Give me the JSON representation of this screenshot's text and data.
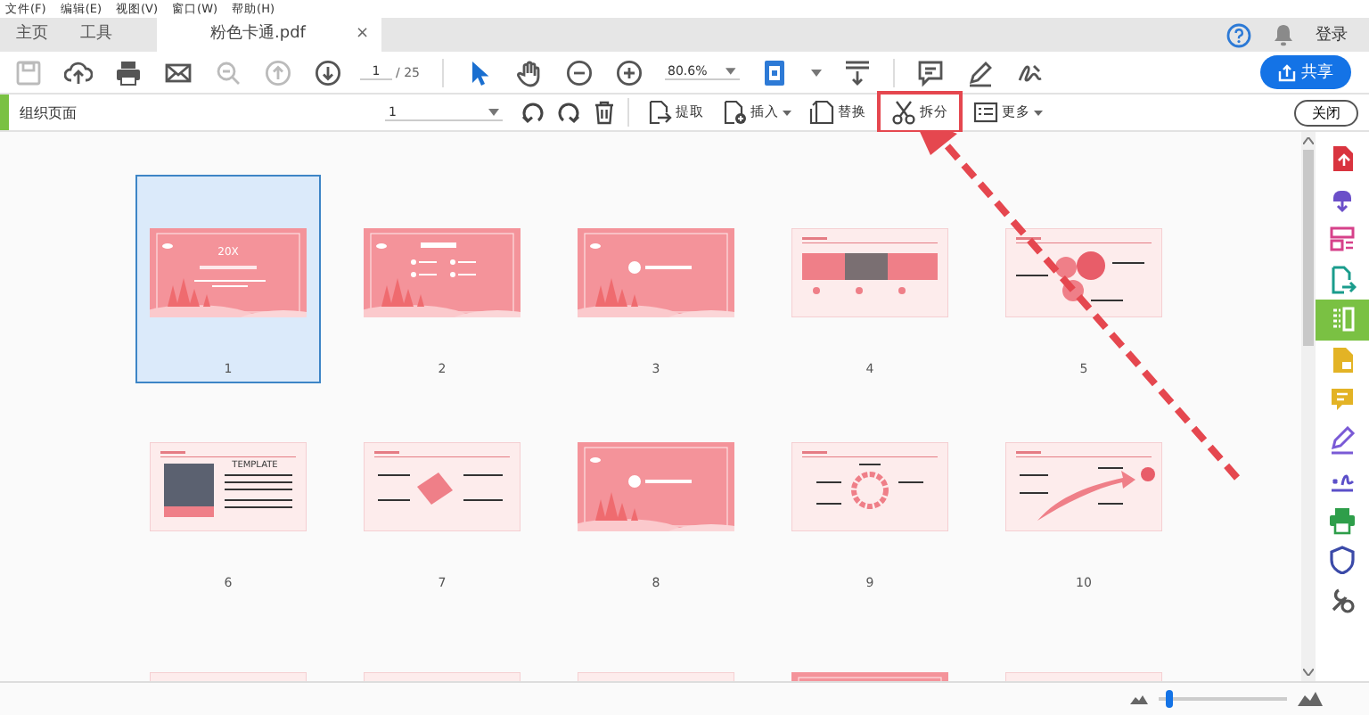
{
  "menu_bar": [
    "文件(F)",
    "编辑(E)",
    "视图(V)",
    "窗口(W)",
    "帮助(H)"
  ],
  "tabs": [
    {
      "label": "主页",
      "selected": false
    },
    {
      "label": "工具",
      "selected": false
    },
    {
      "label": "粉色卡通.pdf",
      "selected": true,
      "close": "×"
    }
  ],
  "account": {
    "sign_in": "登录"
  },
  "toolbar": {
    "page": "1",
    "page_total": "/ 25",
    "zoom": "80.6%",
    "share": "共享"
  },
  "organize_bar": {
    "title": "组织页面",
    "page_select": "1",
    "close": "关闭",
    "tools": [
      {
        "label": "提取",
        "dropdown": false,
        "highlighted": false
      },
      {
        "label": "插入",
        "dropdown": true,
        "highlighted": false
      },
      {
        "label": "替换",
        "dropdown": false,
        "highlighted": false
      },
      {
        "label": "拆分",
        "dropdown": false,
        "highlighted": true
      },
      {
        "label": "更多",
        "dropdown": true,
        "highlighted": false
      }
    ]
  },
  "pages": [
    {
      "label": "1",
      "selected": true,
      "kind": "cover",
      "title": "20X"
    },
    {
      "label": "2",
      "selected": false,
      "kind": "agenda"
    },
    {
      "label": "3",
      "selected": false,
      "kind": "section"
    },
    {
      "label": "4",
      "selected": false,
      "kind": "cards"
    },
    {
      "label": "5",
      "selected": false,
      "kind": "circles"
    },
    {
      "label": "6",
      "selected": false,
      "kind": "photo",
      "title": "TEMPLATE"
    },
    {
      "label": "7",
      "selected": false,
      "kind": "diamond"
    },
    {
      "label": "8",
      "selected": false,
      "kind": "section"
    },
    {
      "label": "9",
      "selected": false,
      "kind": "ring"
    },
    {
      "label": "10",
      "selected": false,
      "kind": "arrow"
    },
    {
      "selected": false,
      "kind": "partial"
    },
    {
      "selected": false,
      "kind": "partial"
    },
    {
      "selected": false,
      "kind": "partial"
    },
    {
      "selected": false,
      "kind": "partial-pink"
    },
    {
      "selected": false,
      "kind": "partial"
    }
  ],
  "tools_panel": [
    {
      "color": "#d9343f",
      "selected": false
    },
    {
      "color": "#6b4fc9",
      "selected": false
    },
    {
      "color": "#d6418a",
      "selected": false
    },
    {
      "color": "#1a9c8c",
      "selected": false
    },
    {
      "color": "#7ac143",
      "selected": true
    },
    {
      "color": "#e3b325",
      "selected": false
    },
    {
      "color": "#e3b325",
      "selected": false
    },
    {
      "color": "#7a5ad6",
      "selected": false
    },
    {
      "color": "#5b4fc9",
      "selected": false
    },
    {
      "color": "#2e9e4a",
      "selected": false
    },
    {
      "color": "#3b4aa8",
      "selected": false
    },
    {
      "color": "#555555",
      "selected": false
    }
  ],
  "thumbnail_size": {
    "level": 0.05
  }
}
